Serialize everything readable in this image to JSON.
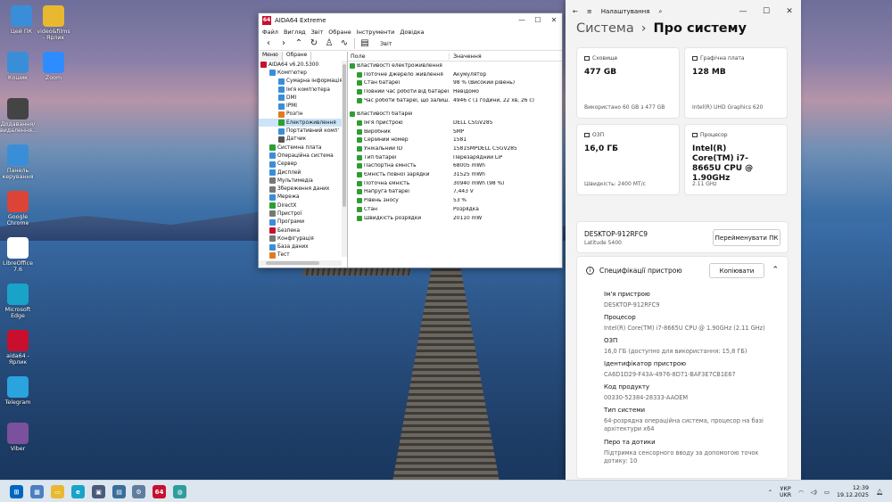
{
  "desktop": {
    "icons": [
      {
        "label": "Цей ПК",
        "icon": "computer-icon",
        "color": "#3a8ed8"
      },
      {
        "label": "video&films - Ярлик",
        "icon": "folder-icon",
        "color": "#e8b830"
      },
      {
        "label": "Кошик",
        "icon": "recycle-bin-icon",
        "color": "#3a8ed8"
      },
      {
        "label": "Zoom",
        "icon": "zoom-icon",
        "color": "#2d8cff"
      },
      {
        "label": "Додавання/видалення...",
        "icon": "settings-disc-icon",
        "color": "#444"
      },
      {
        "label": "Панель керування",
        "icon": "control-panel-icon",
        "color": "#3a8ed8"
      },
      {
        "label": "Google Chrome",
        "icon": "chrome-icon",
        "color": "#dc4437"
      },
      {
        "label": "LibreOffice 7.6",
        "icon": "libreoffice-icon",
        "color": "#ffffff"
      },
      {
        "label": "Microsoft Edge",
        "icon": "edge-icon",
        "color": "#19a3c9"
      },
      {
        "label": "aida64 - Ярлик",
        "icon": "aida64-icon",
        "color": "#c8102e"
      },
      {
        "label": "Telegram",
        "icon": "telegram-icon",
        "color": "#2aa3df"
      },
      {
        "label": "Viber",
        "icon": "viber-icon",
        "color": "#7b519d"
      }
    ]
  },
  "aida": {
    "title": "AIDA64 Extreme",
    "menu": [
      "Файл",
      "Вигляд",
      "Звіт",
      "Обране",
      "Інструменти",
      "Довідка"
    ],
    "report_label": "Звіт",
    "tabs": [
      "Меню",
      "Обране"
    ],
    "tree": [
      {
        "label": "AIDA64 v6.20.5300",
        "color": "#c8102e",
        "indent": 0
      },
      {
        "label": "Комп'ютер",
        "color": "#3a8ed8",
        "indent": 1
      },
      {
        "label": "Сумарна інформація",
        "color": "#3a8ed8",
        "indent": 2
      },
      {
        "label": "Ім'я комп'ютера",
        "color": "#3a8ed8",
        "indent": 2
      },
      {
        "label": "DMI",
        "color": "#3a8ed8",
        "indent": 2
      },
      {
        "label": "IPMI",
        "color": "#3a8ed8",
        "indent": 2
      },
      {
        "label": "Розгін",
        "color": "#e07b20",
        "indent": 2
      },
      {
        "label": "Електроживлення",
        "color": "#2f9d34",
        "indent": 2,
        "selected": true
      },
      {
        "label": "Портативний комп'",
        "color": "#3a8ed8",
        "indent": 2
      },
      {
        "label": "Датчик",
        "color": "#555555",
        "indent": 2
      },
      {
        "label": "Системна плата",
        "color": "#2f9d34",
        "indent": 1
      },
      {
        "label": "Операційна система",
        "color": "#3a8ed8",
        "indent": 1
      },
      {
        "label": "Сервер",
        "color": "#3a8ed8",
        "indent": 1
      },
      {
        "label": "Дисплей",
        "color": "#3a8ed8",
        "indent": 1
      },
      {
        "label": "Мультимедіа",
        "color": "#777777",
        "indent": 1
      },
      {
        "label": "Збереження даних",
        "color": "#777777",
        "indent": 1
      },
      {
        "label": "Мережа",
        "color": "#3a8ed8",
        "indent": 1
      },
      {
        "label": "DirectX",
        "color": "#2f9d34",
        "indent": 1
      },
      {
        "label": "Пристрої",
        "color": "#777777",
        "indent": 1
      },
      {
        "label": "Програми",
        "color": "#3a8ed8",
        "indent": 1
      },
      {
        "label": "Безпека",
        "color": "#c8102e",
        "indent": 1
      },
      {
        "label": "Конфігурація",
        "color": "#777777",
        "indent": 1
      },
      {
        "label": "База даних",
        "color": "#3a8ed8",
        "indent": 1
      },
      {
        "label": "Тест",
        "color": "#e07b20",
        "indent": 1
      }
    ],
    "columns": [
      "Поле",
      "Значення"
    ],
    "groups": [
      {
        "title": "Властивості електроживлення",
        "rows": [
          {
            "field": "Поточне джерело живлення",
            "value": "Акумулятор"
          },
          {
            "field": "Стан батареї",
            "value": "98 % (Високий рівень)"
          },
          {
            "field": "Повний час роботи від батареї",
            "value": "Невідомо"
          },
          {
            "field": "Час роботи батареї, що залиш...",
            "value": "4946 с (1 години, 22 хв, 26 с)"
          }
        ]
      },
      {
        "title": "Властивості батареї",
        "rows": [
          {
            "field": "Ім'я пристрою",
            "value": "DELL C5GV285"
          },
          {
            "field": "Виробник",
            "value": "SMP"
          },
          {
            "field": "Серійний номер",
            "value": "1581"
          },
          {
            "field": "Унікальний ID",
            "value": "1581SMPDELL C5GV285"
          },
          {
            "field": "Тип батареї",
            "value": "Перезарядний LiP"
          },
          {
            "field": "Паспортна ємність",
            "value": "68005 mWh"
          },
          {
            "field": "Ємність повної зарядки",
            "value": "31525 mWh"
          },
          {
            "field": "Поточна ємність",
            "value": "30940 mWh  (98 %)"
          },
          {
            "field": "Напруга батареї",
            "value": "7,443 V"
          },
          {
            "field": "Рівень зносу",
            "value": "53 %"
          },
          {
            "field": "Стан",
            "value": "Розрядка"
          },
          {
            "field": "Швидкість розрядки",
            "value": "20110 mW"
          }
        ]
      }
    ]
  },
  "settings": {
    "title": "Налаштування",
    "breadcrumb_parent": "Система",
    "breadcrumb_current": "Про систему",
    "cards": [
      {
        "label": "Сховище",
        "value": "477 GB",
        "sub": "Використано 60 GB з 477 GB"
      },
      {
        "label": "Графічна плата",
        "value": "128 MB",
        "sub": "Intel(R) UHD Graphics 620"
      },
      {
        "label": "ОЗП",
        "value": "16,0 ГБ",
        "sub": "Швидкість: 2400 МТ/с"
      },
      {
        "label": "Процесор",
        "value": "Intel(R) Core(TM) i7-8665U CPU @ 1.90GHz",
        "sub": "2.11 GHz"
      }
    ],
    "device_name": "DESKTOP-912RFC9",
    "device_model": "Latitude 5400",
    "rename_button": "Перейменувати ПК",
    "specs_title": "Специфікації пристрою",
    "copy_button": "Копіювати",
    "specs": [
      {
        "key": "Ім'я пристрою",
        "value": "DESKTOP-912RFC9"
      },
      {
        "key": "Процесор",
        "value": "Intel(R) Core(TM) i7-8665U CPU @ 1.90GHz (2.11 GHz)"
      },
      {
        "key": "ОЗП",
        "value": "16,0 ГБ (доступно для використання: 15,8 ГБ)"
      },
      {
        "key": "Ідентифікатор пристрою",
        "value": "CA6D1D29-F43A-4976-8D71-BAF3E7CB1E67"
      },
      {
        "key": "Код продукту",
        "value": "00330-52384-28333-AAOEM"
      },
      {
        "key": "Тип системи",
        "value": "64-розрядна операційна система, процесор на базі архітектури x64"
      },
      {
        "key": "Перо та дотики",
        "value": "Підтримка сенсорного вводу за допомогою точок дотику: 10"
      }
    ]
  },
  "taskbar": {
    "apps": [
      {
        "icon": "windows-start-icon",
        "color": "#0067c0",
        "glyph": "⊞"
      },
      {
        "icon": "widgets-icon",
        "color": "#4a7fc1",
        "glyph": "▦"
      },
      {
        "icon": "file-explorer-icon",
        "color": "#e8b830",
        "glyph": "▭"
      },
      {
        "icon": "edge-icon",
        "color": "#19a3c9",
        "glyph": "e"
      },
      {
        "icon": "store-icon",
        "color": "#4a5a7a",
        "glyph": "▣"
      },
      {
        "icon": "media-icon",
        "color": "#3a6e9a",
        "glyph": "▤"
      },
      {
        "icon": "settings-icon",
        "color": "#607d9e",
        "glyph": "⚙"
      },
      {
        "icon": "aida64-icon",
        "color": "#c8102e",
        "glyph": "64"
      },
      {
        "icon": "network-globe-icon",
        "color": "#2f9d9d",
        "glyph": "◍"
      }
    ],
    "lang_top": "УКР",
    "lang_bottom": "UKR",
    "time": "12:39",
    "date": "19.12.2025"
  }
}
